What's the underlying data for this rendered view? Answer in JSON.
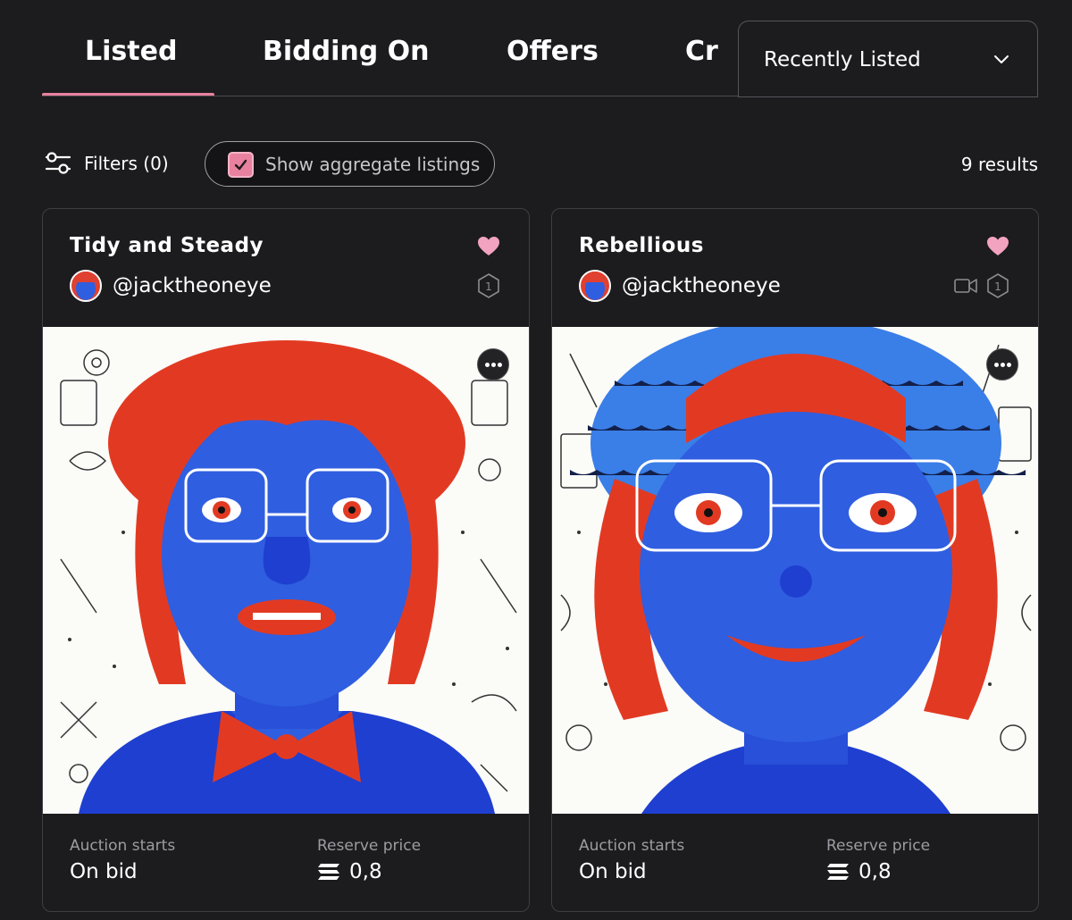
{
  "tabs": [
    {
      "label": "Listed",
      "active": true
    },
    {
      "label": "Bidding On"
    },
    {
      "label": "Offers"
    },
    {
      "label": "Cr"
    }
  ],
  "sort": {
    "label": "Recently Listed",
    "icon": "chevron-down-icon"
  },
  "filters": {
    "label": "Filters (0)",
    "icon": "sliders-icon"
  },
  "aggregate": {
    "label": "Show aggregate listings",
    "checked": true
  },
  "results": "9 results",
  "colors": {
    "accent": "#e8819f",
    "background": "#1c1b1d",
    "card_border": "#3f3e43",
    "art_blue": "#2f5ee0",
    "art_red": "#e23a22"
  },
  "cards": [
    {
      "title": "Tidy and Steady",
      "creator": "@jacktheoneye",
      "edition": "1",
      "has_video": false,
      "auction_label": "Auction starts",
      "auction_value": "On bid",
      "reserve_label": "Reserve price",
      "reserve_value": "0,8",
      "currency_icon": "solana-icon"
    },
    {
      "title": "Rebellious",
      "creator": "@jacktheoneye",
      "edition": "1",
      "has_video": true,
      "auction_label": "Auction starts",
      "auction_value": "On bid",
      "reserve_label": "Reserve price",
      "reserve_value": "0,8",
      "currency_icon": "solana-icon"
    }
  ]
}
